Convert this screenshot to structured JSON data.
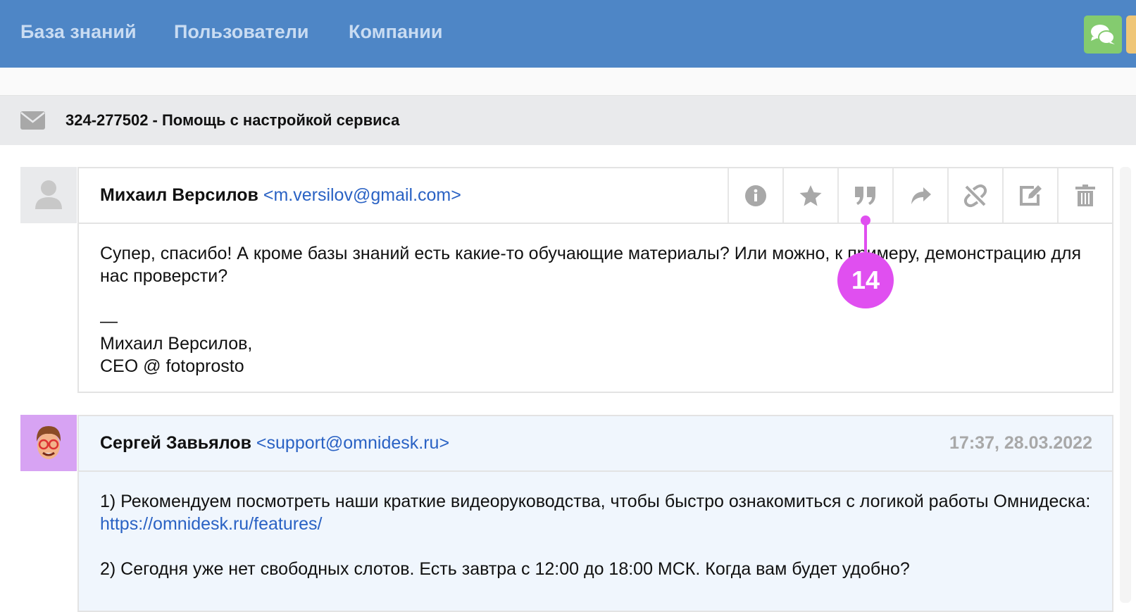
{
  "nav": {
    "items": [
      "База знаний",
      "Пользователи",
      "Компании"
    ]
  },
  "ticket": {
    "title": "324-277502 - Помощь с настройкой сервиса"
  },
  "messages": [
    {
      "name": "Михаил Версилов",
      "email": "<m.versilov@gmail.com>",
      "actions": [
        "info-icon",
        "star-icon",
        "quote-icon",
        "forward-icon",
        "unlink-icon",
        "edit-icon",
        "trash-icon"
      ],
      "body": [
        "Супер, спасибо! А кроме базы знаний есть какие-то обучающие материалы? Или можно, к примеру, демонстрацию для нас проверсти?",
        "",
        "—",
        "Михаил Версилов,",
        "CEO @ fotoprosto"
      ]
    },
    {
      "name": "Сергей Завьялов",
      "email": "<support@omnidesk.ru>",
      "timestamp": "17:37, 28.03.2022",
      "body_line1": "1) Рекомендуем посмотреть наши краткие видеоруководства, чтобы быстро ознакомиться с логикой работы Омнидеска: ",
      "link": "https://omnidesk.ru/features/",
      "body_line2": "2) Сегодня уже нет свободных слотов. Есть завтра с 12:00 до 18:00 МСК. Когда вам будет удобно?"
    }
  ],
  "annotation": {
    "label": "14",
    "color": "#e04ff0"
  },
  "colors": {
    "header": "#4e86c6",
    "chat_button": "#84cb6f",
    "link": "#2a62c4"
  }
}
